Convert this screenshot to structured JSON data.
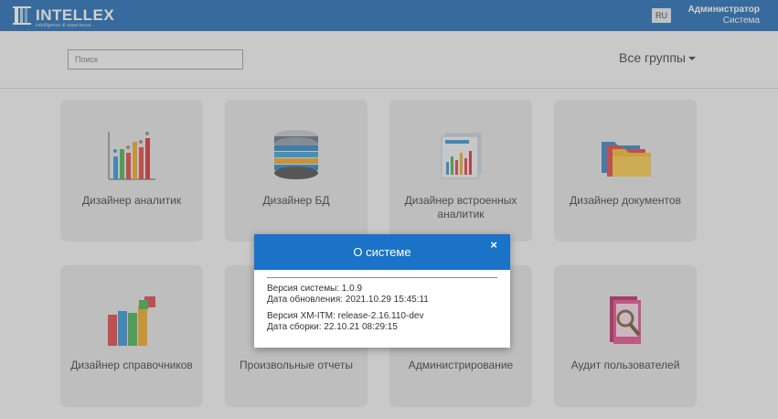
{
  "header": {
    "logo_text": "INTELLEX",
    "logo_sub": "intelligence & experience",
    "language": "RU",
    "user_name": "Администратор",
    "user_role": "Система",
    "bar_color": "#1565b3"
  },
  "toolbar": {
    "search_placeholder": "Поиск",
    "groups_label": "Все группы"
  },
  "tiles": [
    {
      "label": "Дизайнер аналитик",
      "icon": "bar-chart-icon"
    },
    {
      "label": "Дизайнер БД",
      "icon": "database-icon"
    },
    {
      "label": "Дизайнер встроенных аналитик",
      "icon": "embedded-chart-icon"
    },
    {
      "label": "Дизайнер документов",
      "icon": "folders-icon"
    },
    {
      "label": "Дизайнер справочников",
      "icon": "books-icon"
    },
    {
      "label": "Произвольные отчеты",
      "icon": "report-icon"
    },
    {
      "label": "Администрирование",
      "icon": "admin-icon"
    },
    {
      "label": "Аудит пользователей",
      "icon": "audit-icon"
    }
  ],
  "about_dialog": {
    "title": "О системе",
    "close": "×",
    "lines": [
      "Версия системы: 1.0.9",
      "Дата обновления: 2021.10.29 15:45:11",
      "Версия XM-ITM: release-2.16.110-dev",
      "Дата сборки: 22.10.21 08:29:15"
    ],
    "header_color": "#1a73c7"
  }
}
